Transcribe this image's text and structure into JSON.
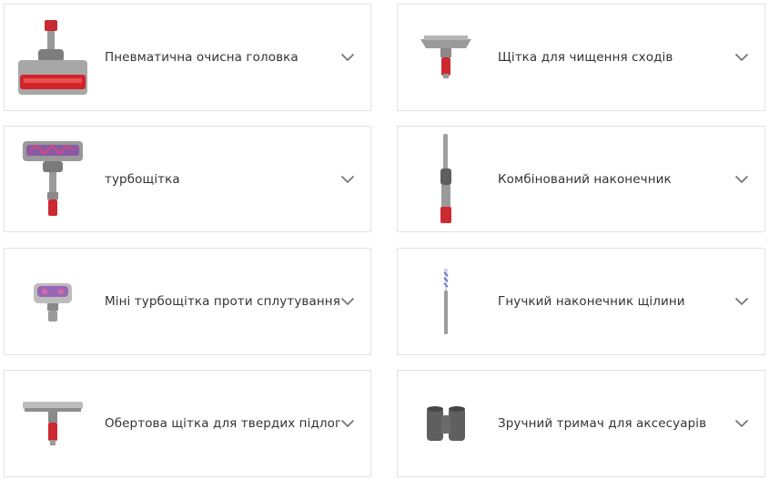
{
  "accessories": [
    {
      "name": "Пневматична очисна головка",
      "icon": "motorhead-icon"
    },
    {
      "name": "Щітка для чищення сходів",
      "icon": "stair-tool-icon"
    },
    {
      "name": "турбощітка",
      "icon": "turbo-brush-icon"
    },
    {
      "name": "Комбінований наконечник",
      "icon": "combination-tool-icon"
    },
    {
      "name": "Міні турбощітка проти сплутування",
      "icon": "mini-turbo-brush-icon"
    },
    {
      "name": "Гнучкий наконечник щілини",
      "icon": "crevice-tool-icon"
    },
    {
      "name": "Обертова щітка для твердих підлог",
      "icon": "hard-floor-brush-icon"
    },
    {
      "name": "Зручний тримач для аксесуарів",
      "icon": "accessory-holder-icon"
    }
  ],
  "colors": {
    "accent_red": "#d1282e",
    "metal_grey": "#8c8c8c",
    "purple": "#8b5aa8",
    "border": "#e2e2e2",
    "text": "#333333"
  }
}
